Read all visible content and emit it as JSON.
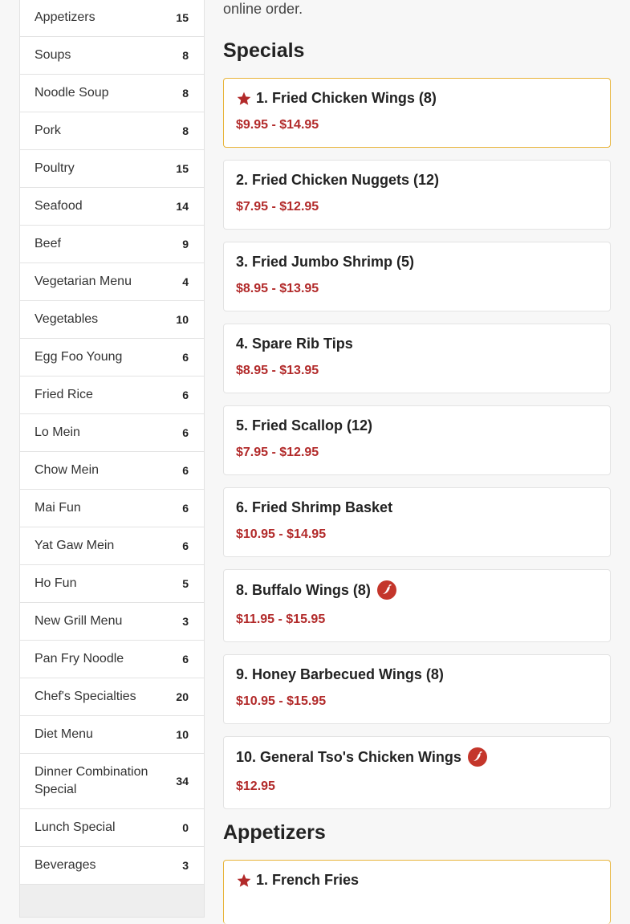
{
  "sidebar": {
    "categories": [
      {
        "name": "Appetizers",
        "count": "15"
      },
      {
        "name": "Soups",
        "count": "8"
      },
      {
        "name": "Noodle Soup",
        "count": "8"
      },
      {
        "name": "Pork",
        "count": "8"
      },
      {
        "name": "Poultry",
        "count": "15"
      },
      {
        "name": "Seafood",
        "count": "14"
      },
      {
        "name": "Beef",
        "count": "9"
      },
      {
        "name": "Vegetarian Menu",
        "count": "4"
      },
      {
        "name": "Vegetables",
        "count": "10"
      },
      {
        "name": "Egg Foo Young",
        "count": "6"
      },
      {
        "name": "Fried Rice",
        "count": "6"
      },
      {
        "name": "Lo Mein",
        "count": "6"
      },
      {
        "name": "Chow Mein",
        "count": "6"
      },
      {
        "name": "Mai Fun",
        "count": "6"
      },
      {
        "name": "Yat Gaw Mein",
        "count": "6"
      },
      {
        "name": "Ho Fun",
        "count": "5"
      },
      {
        "name": "New Grill Menu",
        "count": "3"
      },
      {
        "name": "Pan Fry Noodle",
        "count": "6"
      },
      {
        "name": "Chef's Specialties",
        "count": "20"
      },
      {
        "name": "Diet Menu",
        "count": "10"
      },
      {
        "name": "Dinner Combination Special",
        "count": "34"
      },
      {
        "name": "Lunch Special",
        "count": "0"
      },
      {
        "name": "Beverages",
        "count": "3"
      }
    ]
  },
  "main": {
    "intro": "online order.",
    "specials": {
      "title": "Specials",
      "items": [
        {
          "name": "1. Fried Chicken Wings (8)",
          "price": "$9.95 - $14.95",
          "featured": true,
          "spicy": false
        },
        {
          "name": "2. Fried Chicken Nuggets (12)",
          "price": "$7.95 - $12.95",
          "featured": false,
          "spicy": false
        },
        {
          "name": "3. Fried Jumbo Shrimp (5)",
          "price": "$8.95 - $13.95",
          "featured": false,
          "spicy": false
        },
        {
          "name": "4. Spare Rib Tips",
          "price": "$8.95 - $13.95",
          "featured": false,
          "spicy": false
        },
        {
          "name": "5. Fried Scallop (12)",
          "price": "$7.95 - $12.95",
          "featured": false,
          "spicy": false
        },
        {
          "name": "6. Fried Shrimp Basket",
          "price": "$10.95 - $14.95",
          "featured": false,
          "spicy": false
        },
        {
          "name": "8. Buffalo Wings (8)",
          "price": "$11.95 - $15.95",
          "featured": false,
          "spicy": true
        },
        {
          "name": "9. Honey Barbecued Wings (8)",
          "price": "$10.95 - $15.95",
          "featured": false,
          "spicy": false
        },
        {
          "name": "10. General Tso's Chicken Wings",
          "price": "$12.95",
          "featured": false,
          "spicy": true
        }
      ]
    },
    "appetizers": {
      "title": "Appetizers",
      "items": [
        {
          "name": "1. French Fries",
          "featured": true,
          "spicy": false
        }
      ]
    }
  },
  "colors": {
    "price": "#b22a2a",
    "featured_border": "#e8b43a",
    "star": "#b22a2a",
    "spicy_badge": "#c4362b"
  },
  "icons": {
    "featured": "star-icon",
    "spicy": "chili-pepper-icon"
  }
}
